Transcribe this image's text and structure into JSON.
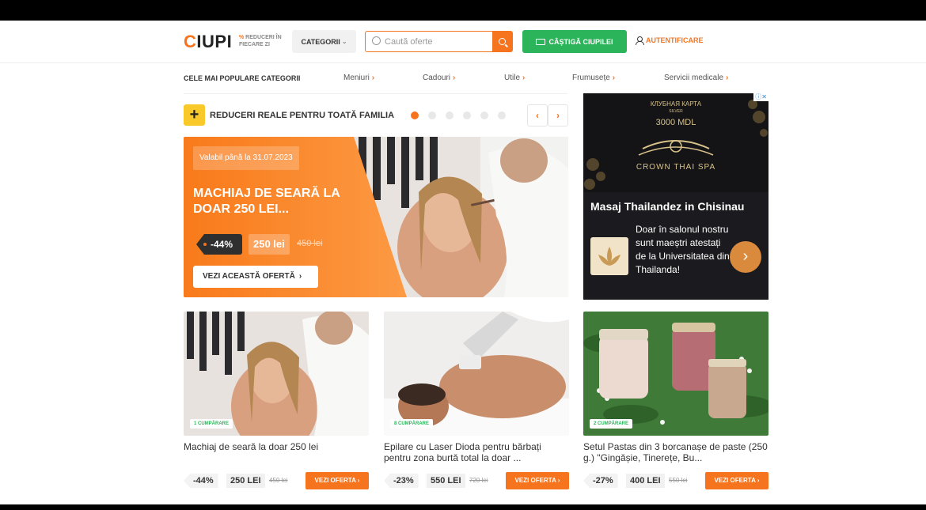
{
  "header": {
    "logo_c": "C",
    "logo_rest": "IUPI",
    "tagline_pct": "%",
    "tagline": " REDUCERI ÎN FIECARE ZI",
    "categories_button": "CATEGORII",
    "search_placeholder": "Caută oferte",
    "earn_button": "CÂȘTIGĂ CIUPILEI",
    "login": "AUTENTIFICARE"
  },
  "category_bar": {
    "title": "CELE MAI POPULARE CATEGORII",
    "items": [
      "Meniuri",
      "Cadouri",
      "Utile",
      "Frumusețe",
      "Servicii medicale"
    ]
  },
  "slider": {
    "title": "REDUCERI REALE PENTRU TOATĂ FAMILIA",
    "plus": "+",
    "prev": "‹",
    "next": "›",
    "dot_count": 6,
    "active_dot": 0
  },
  "hero": {
    "valid": "Valabil până la 31.07.2023",
    "title": "MACHIAJ DE SEARĂ LA DOAR 250 LEI...",
    "discount": "-44%",
    "price": "250 lei",
    "old_price": "450 lei",
    "cta": "VEZI ACEASTĂ OFERTĂ",
    "cta_chevron": "›"
  },
  "ad": {
    "ad_marker": "ⓘ✕",
    "card_title": "КЛУБНАЯ КАРТА",
    "card_sub": "SILVER",
    "card_amount": "3000 MDL",
    "brand": "CROWN THAI SPA",
    "title": "Masaj Thailandez in Chisinau",
    "text": "Doar în salonul nostru sunt maeștri atestați de la Universitatea din Thailanda!",
    "arrow": "›"
  },
  "cards": [
    {
      "bought": "1 CUMPĂRARE",
      "title": "Machiaj de seară la doar 250 lei",
      "discount": "-44%",
      "price": "250 LEI",
      "old_price": "450 lei",
      "button": "VEZI OFERTA ›"
    },
    {
      "bought": "8 CUMPĂRARE",
      "title": "Epilare cu Laser Dioda pentru bărbați pentru zona burtă total la doar ...",
      "discount": "-23%",
      "price": "550 LEI",
      "old_price": "720 lei",
      "button": "VEZI OFERTA ›"
    },
    {
      "bought": "2 CUMPĂRARE",
      "title": "Setul Pastas din 3 borcanașe de paste (250 g.) \"Gingășie, Tinerețe, Bu...",
      "discount": "-27%",
      "price": "400 LEI",
      "old_price": "550 lei",
      "button": "VEZI OFERTA ›"
    }
  ],
  "colors": {
    "accent": "#f7741e",
    "green": "#2bb45a",
    "yellow": "#f9c929"
  }
}
